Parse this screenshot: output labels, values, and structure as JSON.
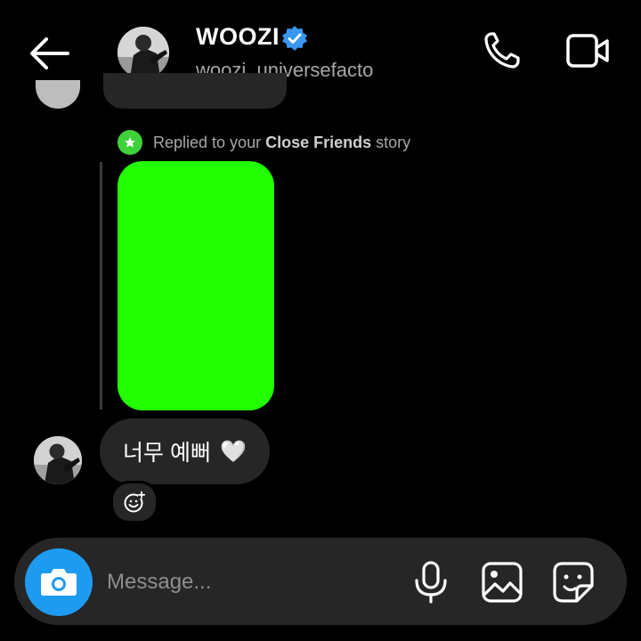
{
  "header": {
    "name": "WOOZI",
    "username": "woozi_universefacto",
    "verified": true,
    "icons": [
      "back-arrow-icon",
      "verified-badge-icon",
      "phone-icon",
      "video-camera-icon"
    ]
  },
  "thread": {
    "reply_note": {
      "prefix": "Replied to your ",
      "highlight": "Close Friends",
      "suffix": " story",
      "badge_color": "#3fd13a"
    },
    "story_color": "#22ff00",
    "message": {
      "text": "너무 예뻐",
      "emoji": "🤍"
    },
    "reaction_icon": "add-reaction-icon"
  },
  "composer": {
    "placeholder": "Message...",
    "camera_color": "#1d9bf0",
    "icons": [
      "camera-icon",
      "microphone-icon",
      "gallery-icon",
      "sticker-icon"
    ]
  }
}
